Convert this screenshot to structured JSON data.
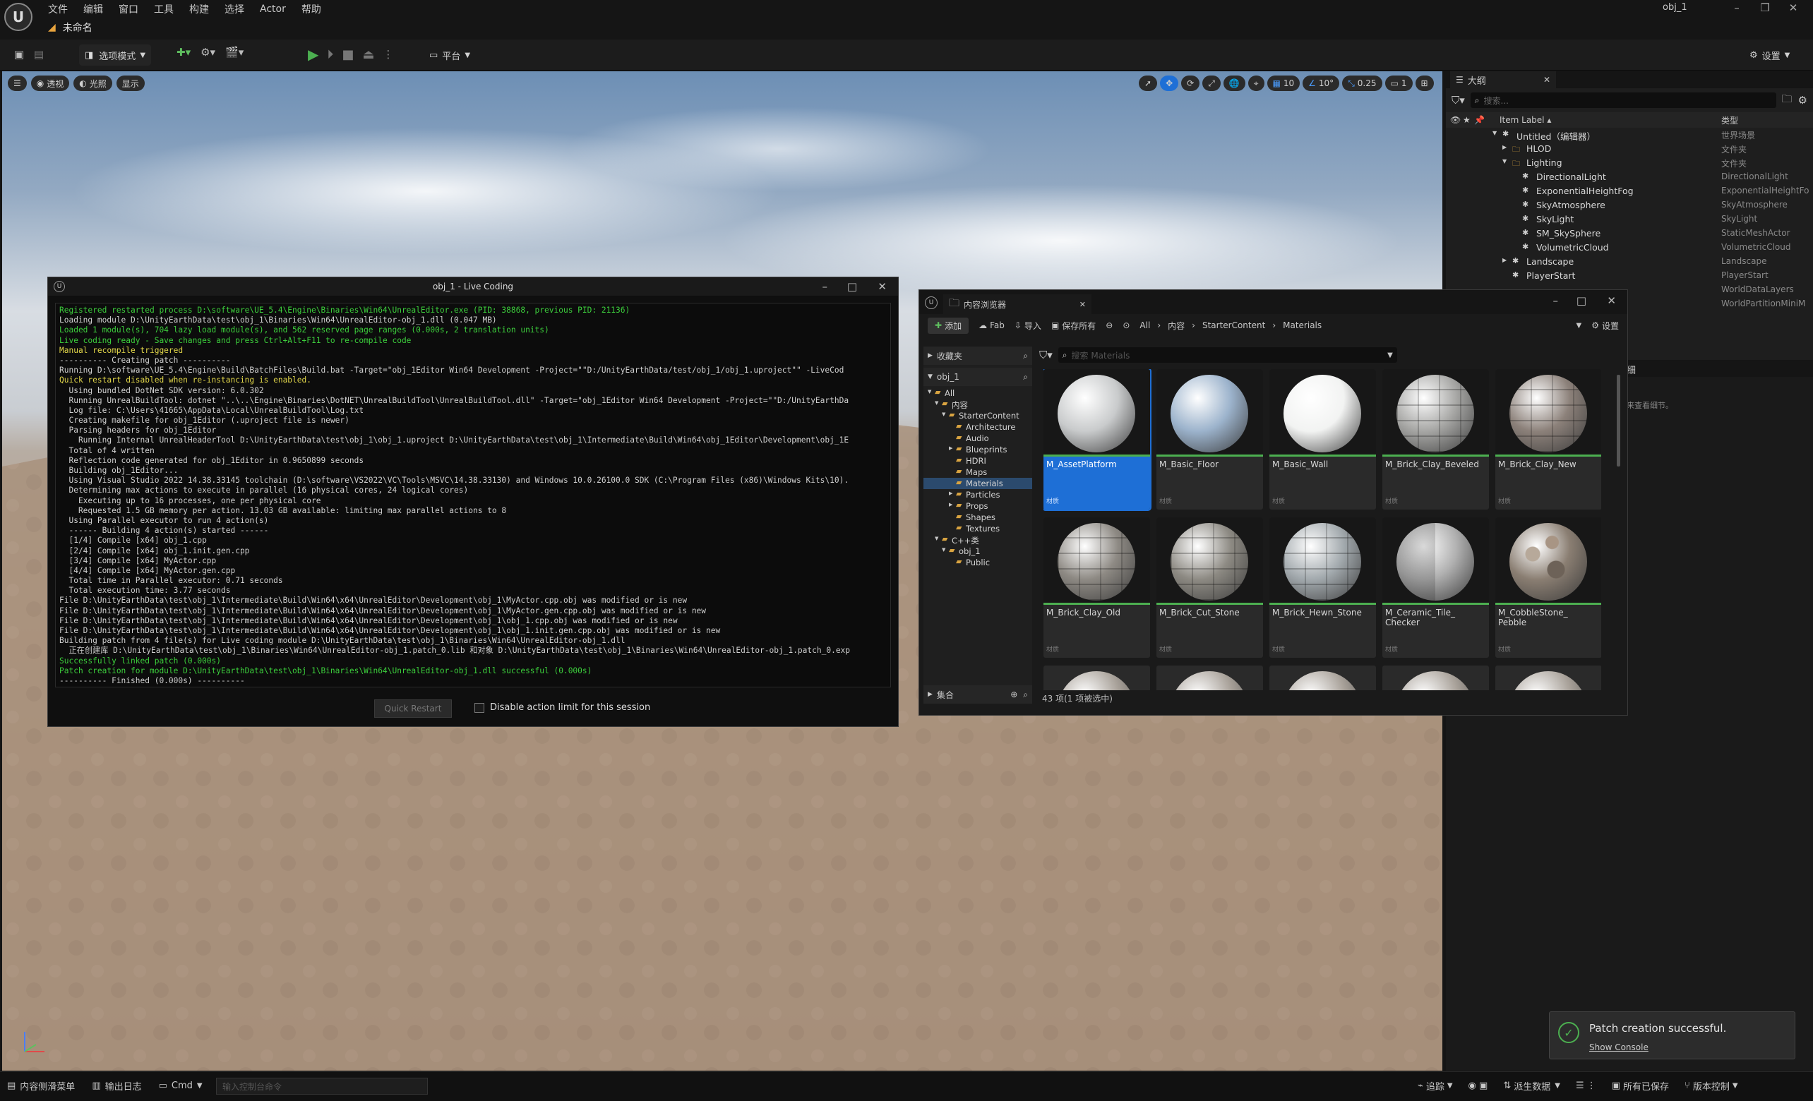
{
  "app": {
    "title": "obj_1",
    "doc_tab": "未命名"
  },
  "menu": [
    "文件",
    "编辑",
    "窗口",
    "工具",
    "构建",
    "选择",
    "Actor",
    "帮助"
  ],
  "toolbar": {
    "mode": "选项模式",
    "platform": "平台",
    "settings": "设置"
  },
  "viewport": {
    "view": "透视",
    "lighting": "光照",
    "show": "显示",
    "grid": "10",
    "rot": "10°",
    "scale": "0.25",
    "cam": "1"
  },
  "outliner": {
    "title": "大纲",
    "search": "搜索...",
    "col_label": "Item Label ▴",
    "col_type": "类型",
    "rows": [
      {
        "label": "Untitled（编辑器）",
        "type": "世界场景",
        "indent": 0,
        "icon": "world-icon"
      },
      {
        "label": "HLOD",
        "type": "文件夹",
        "indent": 1,
        "icon": "folder-icon"
      },
      {
        "label": "Lighting",
        "type": "文件夹",
        "indent": 1,
        "icon": "folder-icon"
      },
      {
        "label": "DirectionalLight",
        "type": "DirectionalLight",
        "indent": 2,
        "icon": "light-icon"
      },
      {
        "label": "ExponentialHeightFog",
        "type": "ExponentialHeightFo",
        "indent": 2,
        "icon": "fog-icon"
      },
      {
        "label": "SkyAtmosphere",
        "type": "SkyAtmosphere",
        "indent": 2,
        "icon": "sky-icon"
      },
      {
        "label": "SkyLight",
        "type": "SkyLight",
        "indent": 2,
        "icon": "skylight-icon"
      },
      {
        "label": "SM_SkySphere",
        "type": "StaticMeshActor",
        "indent": 2,
        "icon": "mesh-icon"
      },
      {
        "label": "VolumetricCloud",
        "type": "VolumetricCloud",
        "indent": 2,
        "icon": "cloud-icon"
      },
      {
        "label": "Landscape",
        "type": "Landscape",
        "indent": 1,
        "icon": "landscape-icon"
      },
      {
        "label": "PlayerStart",
        "type": "PlayerStart",
        "indent": 1,
        "icon": "player-icon"
      },
      {
        "label": "",
        "type": "WorldDataLayers",
        "indent": 1,
        "icon": ""
      },
      {
        "label": "",
        "type": "WorldPartitionMiniM",
        "indent": 1,
        "icon": ""
      }
    ]
  },
  "details": {
    "tab": "细",
    "hint": "来查看细节。"
  },
  "live_coding": {
    "title": "obj_1 - Live Coding",
    "quick_restart": "Quick Restart",
    "disable_limit": "Disable action limit for this session",
    "lines": [
      {
        "c": "g",
        "t": "Registered restarted process D:\\software\\UE_5.4\\Engine\\Binaries\\Win64\\UnrealEditor.exe (PID: 38868, previous PID: 21136)"
      },
      {
        "c": "w",
        "t": "Loading module D:\\UnityEarthData\\test\\obj_1\\Binaries\\Win64\\UnrealEditor-obj_1.dll (0.047 MB)"
      },
      {
        "c": "g",
        "t": "Loaded 1 module(s), 704 lazy load module(s), and 562 reserved page ranges (0.000s, 2 translation units)"
      },
      {
        "c": "g",
        "t": "Live coding ready - Save changes and press Ctrl+Alt+F11 to re-compile code"
      },
      {
        "c": "y",
        "t": "Manual recompile triggered"
      },
      {
        "c": "w",
        "t": "---------- Creating patch ----------"
      },
      {
        "c": "w",
        "t": "Running D:\\software\\UE_5.4\\Engine\\Build\\BatchFiles\\Build.bat -Target=\"obj_1Editor Win64 Development -Project=\"\"D:/UnityEarthData/test/obj_1/obj_1.uproject\"\" -LiveCod"
      },
      {
        "c": "y",
        "t": "Quick restart disabled when re-instancing is enabled."
      },
      {
        "c": "w",
        "t": "  Using bundled DotNet SDK version: 6.0.302"
      },
      {
        "c": "w",
        "t": "  Running UnrealBuildTool: dotnet \"..\\..\\Engine\\Binaries\\DotNET\\UnrealBuildTool\\UnrealBuildTool.dll\" -Target=\"obj_1Editor Win64 Development -Project=\"\"D:/UnityEarthDa"
      },
      {
        "c": "w",
        "t": "  Log file: C:\\Users\\41665\\AppData\\Local\\UnrealBuildTool\\Log.txt"
      },
      {
        "c": "w",
        "t": "  Creating makefile for obj_1Editor (.uproject file is newer)"
      },
      {
        "c": "w",
        "t": "  Parsing headers for obj_1Editor"
      },
      {
        "c": "w",
        "t": "    Running Internal UnrealHeaderTool D:\\UnityEarthData\\test\\obj_1\\obj_1.uproject D:\\UnityEarthData\\test\\obj_1\\Intermediate\\Build\\Win64\\obj_1Editor\\Development\\obj_1E"
      },
      {
        "c": "w",
        "t": "  Total of 4 written"
      },
      {
        "c": "w",
        "t": "  Reflection code generated for obj_1Editor in 0.9650899 seconds"
      },
      {
        "c": "w",
        "t": "  Building obj_1Editor..."
      },
      {
        "c": "w",
        "t": "  Using Visual Studio 2022 14.38.33145 toolchain (D:\\software\\VS2022\\VC\\Tools\\MSVC\\14.38.33130) and Windows 10.0.26100.0 SDK (C:\\Program Files (x86)\\Windows Kits\\10)."
      },
      {
        "c": "w",
        "t": "  Determining max actions to execute in parallel (16 physical cores, 24 logical cores)"
      },
      {
        "c": "w",
        "t": "    Executing up to 16 processes, one per physical core"
      },
      {
        "c": "w",
        "t": "    Requested 1.5 GB memory per action. 13.03 GB available: limiting max parallel actions to 8"
      },
      {
        "c": "w",
        "t": "  Using Parallel executor to run 4 action(s)"
      },
      {
        "c": "w",
        "t": "  ------ Building 4 action(s) started ------"
      },
      {
        "c": "w",
        "t": "  [1/4] Compile [x64] obj_1.cpp"
      },
      {
        "c": "w",
        "t": "  [2/4] Compile [x64] obj_1.init.gen.cpp"
      },
      {
        "c": "w",
        "t": "  [3/4] Compile [x64] MyActor.cpp"
      },
      {
        "c": "w",
        "t": "  [4/4] Compile [x64] MyActor.gen.cpp"
      },
      {
        "c": "w",
        "t": "  Total time in Parallel executor: 0.71 seconds"
      },
      {
        "c": "w",
        "t": "  Total execution time: 3.77 seconds"
      },
      {
        "c": "w",
        "t": "File D:\\UnityEarthData\\test\\obj_1\\Intermediate\\Build\\Win64\\x64\\UnrealEditor\\Development\\obj_1\\MyActor.cpp.obj was modified or is new"
      },
      {
        "c": "w",
        "t": "File D:\\UnityEarthData\\test\\obj_1\\Intermediate\\Build\\Win64\\x64\\UnrealEditor\\Development\\obj_1\\MyActor.gen.cpp.obj was modified or is new"
      },
      {
        "c": "w",
        "t": "File D:\\UnityEarthData\\test\\obj_1\\Intermediate\\Build\\Win64\\x64\\UnrealEditor\\Development\\obj_1\\obj_1.cpp.obj was modified or is new"
      },
      {
        "c": "w",
        "t": "File D:\\UnityEarthData\\test\\obj_1\\Intermediate\\Build\\Win64\\x64\\UnrealEditor\\Development\\obj_1\\obj_1.init.gen.cpp.obj was modified or is new"
      },
      {
        "c": "w",
        "t": "Building patch from 4 file(s) for Live coding module D:\\UnityEarthData\\test\\obj_1\\Binaries\\Win64\\UnrealEditor-obj_1.dll"
      },
      {
        "c": "w",
        "t": "  正在创建库 D:\\UnityEarthData\\test\\obj_1\\Binaries\\Win64\\UnrealEditor-obj_1.patch_0.lib 和对象 D:\\UnityEarthData\\test\\obj_1\\Binaries\\Win64\\UnrealEditor-obj_1.patch_0.exp"
      },
      {
        "c": "g",
        "t": "Successfully linked patch (0.000s)"
      },
      {
        "c": "g",
        "t": "Patch creation for module D:\\UnityEarthData\\test\\obj_1\\Binaries\\Win64\\UnrealEditor-obj_1.dll successful (0.000s)"
      },
      {
        "c": "w",
        "t": "---------- Finished (0.000s) ----------"
      }
    ],
    "progress": 0.4
  },
  "content_browser": {
    "title": "内容浏览器",
    "add": "添加",
    "fab": "Fab",
    "import": "导入",
    "save_all": "保存所有",
    "settings": "设置",
    "breadcrumb": [
      "All",
      "内容",
      "StarterContent",
      "Materials"
    ],
    "favorites": "收藏夹",
    "project": "obj_1",
    "search": "搜索 Materials",
    "collections": "集合",
    "status": "43 项(1 项被选中)",
    "tree": [
      {
        "label": "All",
        "indent": 0
      },
      {
        "label": "内容",
        "indent": 1
      },
      {
        "label": "StarterContent",
        "indent": 2
      },
      {
        "label": "Architecture",
        "indent": 3
      },
      {
        "label": "Audio",
        "indent": 3
      },
      {
        "label": "Blueprints",
        "indent": 3
      },
      {
        "label": "HDRI",
        "indent": 3
      },
      {
        "label": "Maps",
        "indent": 3
      },
      {
        "label": "Materials",
        "indent": 3,
        "selected": true
      },
      {
        "label": "Particles",
        "indent": 3
      },
      {
        "label": "Props",
        "indent": 3
      },
      {
        "label": "Shapes",
        "indent": 3
      },
      {
        "label": "Textures",
        "indent": 3
      },
      {
        "label": "C++类",
        "indent": 1
      },
      {
        "label": "obj_1",
        "indent": 2
      },
      {
        "label": "Public",
        "indent": 3
      }
    ],
    "assets": [
      {
        "name": "M_AssetPlatform",
        "type": "材质",
        "color": "#c9cbcc",
        "selected": true
      },
      {
        "name": "M_Basic_Floor",
        "type": "材质",
        "color": "#9cb3cc"
      },
      {
        "name": "M_Basic_Wall",
        "type": "材质",
        "color": "#f2f3f2"
      },
      {
        "name": "M_Brick_Clay_Beveled",
        "type": "材质",
        "color": "#a6a6a4"
      },
      {
        "name": "M_Brick_Clay_New",
        "type": "材质",
        "color": "#8c817a"
      },
      {
        "name": "M_Brick_Clay_Old",
        "type": "材质",
        "color": "#8e8a84"
      },
      {
        "name": "M_Brick_Cut_Stone",
        "type": "材质",
        "color": "#8d8a83"
      },
      {
        "name": "M_Brick_Hewn_Stone",
        "type": "材质",
        "color": "#a2a9ad"
      },
      {
        "name": "M_Ceramic_Tile_\nChecker",
        "type": "材质",
        "color": "#b0b0b0"
      },
      {
        "name": "M_CobbleStone_\nPebble",
        "type": "材质",
        "color": "#8a7e72"
      }
    ]
  },
  "status": {
    "content_drawer": "内容侧滑菜单",
    "output_log": "输出日志",
    "cmd": "Cmd",
    "cmd_placeholder": "输入控制台命令",
    "trace": "追踪",
    "derived": "派生数据",
    "saved": "所有已保存",
    "vc": "版本控制"
  },
  "toast": {
    "message": "Patch creation successful.",
    "link": "Show Console"
  }
}
